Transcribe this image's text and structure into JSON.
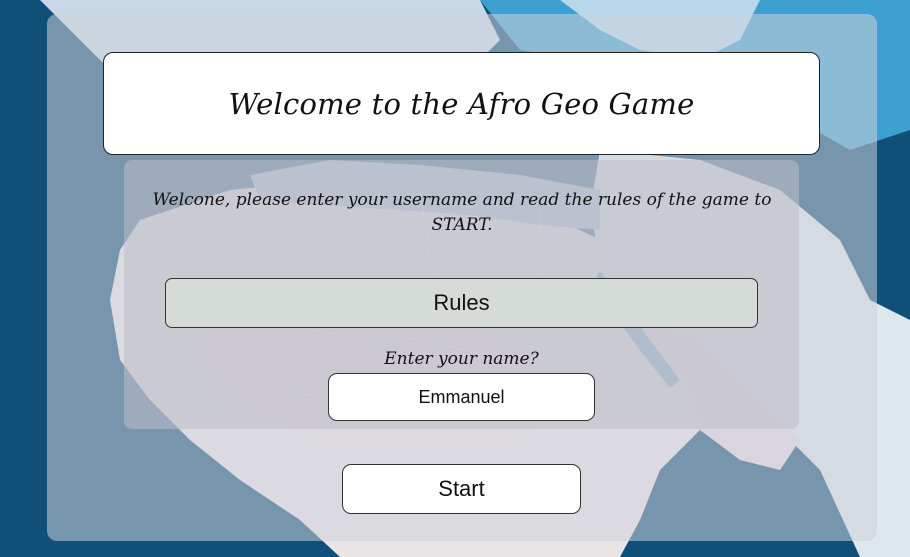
{
  "header": {
    "title": "Welcome to the Afro Geo Game"
  },
  "intro": {
    "text": "Welcone, please enter your username and read the rules of the game to START."
  },
  "rules_button": {
    "label": "Rules"
  },
  "name_field": {
    "label": "Enter your name?",
    "value": "Emmanuel"
  },
  "start_button": {
    "label": "Start"
  },
  "colors": {
    "ocean": "#0f4f78",
    "land": "#d9e3ec",
    "panel_overlay": "#cdd2da",
    "rules_button_bg": "#d5dbd6",
    "button_bg": "#ffffff"
  },
  "background": {
    "icon": "world-map-europe-africa"
  }
}
